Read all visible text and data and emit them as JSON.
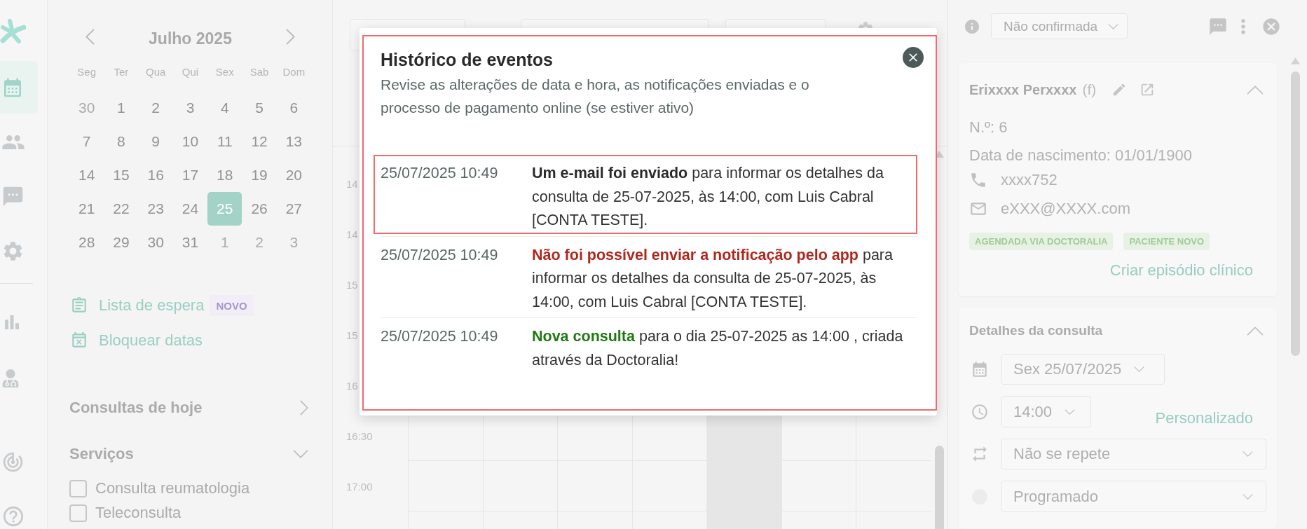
{
  "nav_rail": [
    {
      "selected": true
    },
    {
      "selected": false
    },
    {
      "selected": false
    },
    {
      "selected": false
    },
    {
      "selected": false
    },
    {
      "selected": false
    },
    {
      "selected": false
    },
    {
      "selected": false
    }
  ],
  "calendar": {
    "title": "Julho 2025",
    "weekdays": [
      "Seg",
      "Ter",
      "Qua",
      "Qui",
      "Sex",
      "Sab",
      "Dom"
    ],
    "days": [
      {
        "day": "30",
        "muted": true,
        "selected": false
      },
      {
        "day": "1",
        "muted": false,
        "selected": false
      },
      {
        "day": "2",
        "muted": false,
        "selected": false
      },
      {
        "day": "3",
        "muted": false,
        "selected": false
      },
      {
        "day": "4",
        "muted": false,
        "selected": false
      },
      {
        "day": "5",
        "muted": false,
        "selected": false
      },
      {
        "day": "6",
        "muted": false,
        "selected": false
      },
      {
        "day": "7",
        "muted": false,
        "selected": false
      },
      {
        "day": "8",
        "muted": false,
        "selected": false
      },
      {
        "day": "9",
        "muted": false,
        "selected": false
      },
      {
        "day": "10",
        "muted": false,
        "selected": false
      },
      {
        "day": "11",
        "muted": false,
        "selected": false
      },
      {
        "day": "12",
        "muted": false,
        "selected": false
      },
      {
        "day": "13",
        "muted": false,
        "selected": false
      },
      {
        "day": "14",
        "muted": false,
        "selected": false
      },
      {
        "day": "15",
        "muted": false,
        "selected": false
      },
      {
        "day": "16",
        "muted": false,
        "selected": false
      },
      {
        "day": "17",
        "muted": false,
        "selected": false
      },
      {
        "day": "18",
        "muted": false,
        "selected": false
      },
      {
        "day": "19",
        "muted": false,
        "selected": false
      },
      {
        "day": "20",
        "muted": false,
        "selected": false
      },
      {
        "day": "21",
        "muted": false,
        "selected": false
      },
      {
        "day": "22",
        "muted": false,
        "selected": false
      },
      {
        "day": "23",
        "muted": false,
        "selected": false
      },
      {
        "day": "24",
        "muted": false,
        "selected": false
      },
      {
        "day": "25",
        "muted": false,
        "selected": true
      },
      {
        "day": "26",
        "muted": false,
        "selected": false
      },
      {
        "day": "27",
        "muted": false,
        "selected": false
      },
      {
        "day": "28",
        "muted": false,
        "selected": false
      },
      {
        "day": "29",
        "muted": false,
        "selected": false
      },
      {
        "day": "30",
        "muted": false,
        "selected": false
      },
      {
        "day": "31",
        "muted": false,
        "selected": false
      },
      {
        "day": "1",
        "muted": true,
        "selected": false
      },
      {
        "day": "2",
        "muted": true,
        "selected": false
      },
      {
        "day": "3",
        "muted": true,
        "selected": false
      }
    ]
  },
  "shortcuts": [
    {
      "label": "Lista de espera",
      "badge": "NOVO"
    },
    {
      "label": "Bloquear datas"
    }
  ],
  "today_section": {
    "title": "Consultas de hoje",
    "expanded": false
  },
  "services": {
    "title": "Serviços",
    "expanded": true,
    "options": [
      {
        "label": "Consulta reumatologia",
        "checked": false
      },
      {
        "label": "Teleconsulta",
        "checked": false
      }
    ]
  },
  "schedule": {
    "time_labels": [
      "14",
      "14",
      "15",
      "15",
      "16",
      "16:30",
      "17:00"
    ],
    "days": [
      {
        "selected": false
      },
      {
        "selected": false
      },
      {
        "selected": false
      },
      {
        "selected": false
      },
      {
        "selected": true
      },
      {
        "selected": false
      },
      {
        "selected": false
      }
    ]
  },
  "event_history": {
    "title": "Histórico de eventos",
    "subtitle": "Revise as alterações de data e hora, as notificações enviadas e o processo de pagamento online (se estiver ativo)",
    "events": [
      {
        "time": "25/07/2025 10:49",
        "kind": "neutral",
        "headline": "Um e-mail foi enviado",
        "text": "para informar os detalhes da consulta de 25-07-2025, às 14:00, com Luis Cabral [CONTA TESTE].",
        "highlighted": true
      },
      {
        "time": "25/07/2025 10:49",
        "kind": "error",
        "headline": "Não foi possível enviar a notificação pelo app",
        "text": "para informar os detalhes da consulta de 25-07-2025, às 14:00, com Luis Cabral [CONTA TESTE].",
        "highlighted": false
      },
      {
        "time": "25/07/2025 10:49",
        "kind": "success",
        "headline": "Nova consulta",
        "text": "para o dia 25-07-2025 as 14:00 , criada através da Doctoralia!",
        "highlighted": false
      }
    ]
  },
  "appointment_panel": {
    "status": "Não confirmada",
    "patient": {
      "name": "Erixxxx Perxxxx",
      "gender": "(f)",
      "expanded": true,
      "number": "N.º: 6",
      "birth_date": "Data de nascimento: 01/01/1900",
      "phone": "xxxx752",
      "email": "eXXX@XXXX.com",
      "tags": [
        "AGENDADA VIA DOCTORALIA",
        "PACIENTE NOVO"
      ],
      "action": "Criar episódio clínico"
    },
    "details": {
      "title": "Detalhes da consulta",
      "expanded": true,
      "date": "Sex 25/07/2025",
      "time": "14:00",
      "time_action": "Personalizado",
      "repeat": "Não se repete",
      "state": "Programado"
    }
  }
}
